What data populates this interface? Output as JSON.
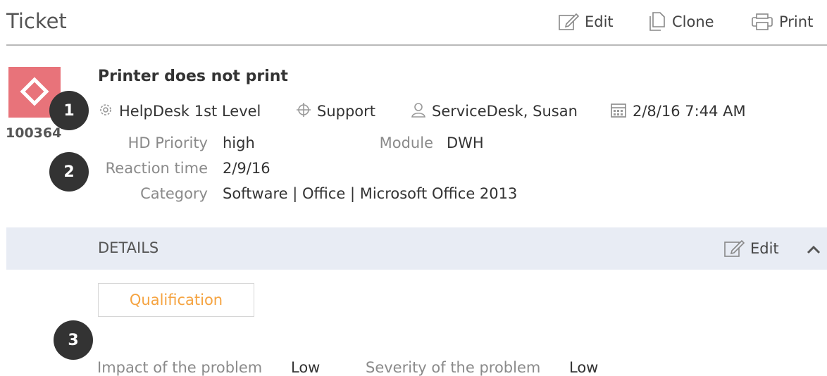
{
  "header": {
    "title": "Ticket",
    "edit_label": "Edit",
    "clone_label": "Clone",
    "print_label": "Print"
  },
  "ticket": {
    "id": "100364",
    "title": "Printer does not print",
    "meta": {
      "group": "HelpDesk 1st Level",
      "service": "Support",
      "assignee": "ServiceDesk, Susan",
      "date": "2/8/16 7:44 AM"
    },
    "fields": {
      "hd_priority_label": "HD Priority",
      "hd_priority_value": "high",
      "module_label": "Module",
      "module_value": "DWH",
      "reaction_time_label": "Reaction time",
      "reaction_time_value": "2/9/16",
      "category_label": "Category",
      "category_value": "Software | Office | Microsoft Office 2013"
    }
  },
  "details": {
    "title": "DETAILS",
    "edit_label": "Edit",
    "qualification_label": "Qualification",
    "impact_label": "Impact of the problem",
    "impact_value": "Low",
    "severity_label": "Severity of the problem",
    "severity_value": "Low"
  },
  "badges": {
    "b1": "1",
    "b2": "2",
    "b3": "3"
  },
  "colors": {
    "ticket_icon": "#e8737a",
    "details_bar": "#e8ecf4",
    "qualification_text": "#f5a340",
    "badge": "#333333"
  }
}
